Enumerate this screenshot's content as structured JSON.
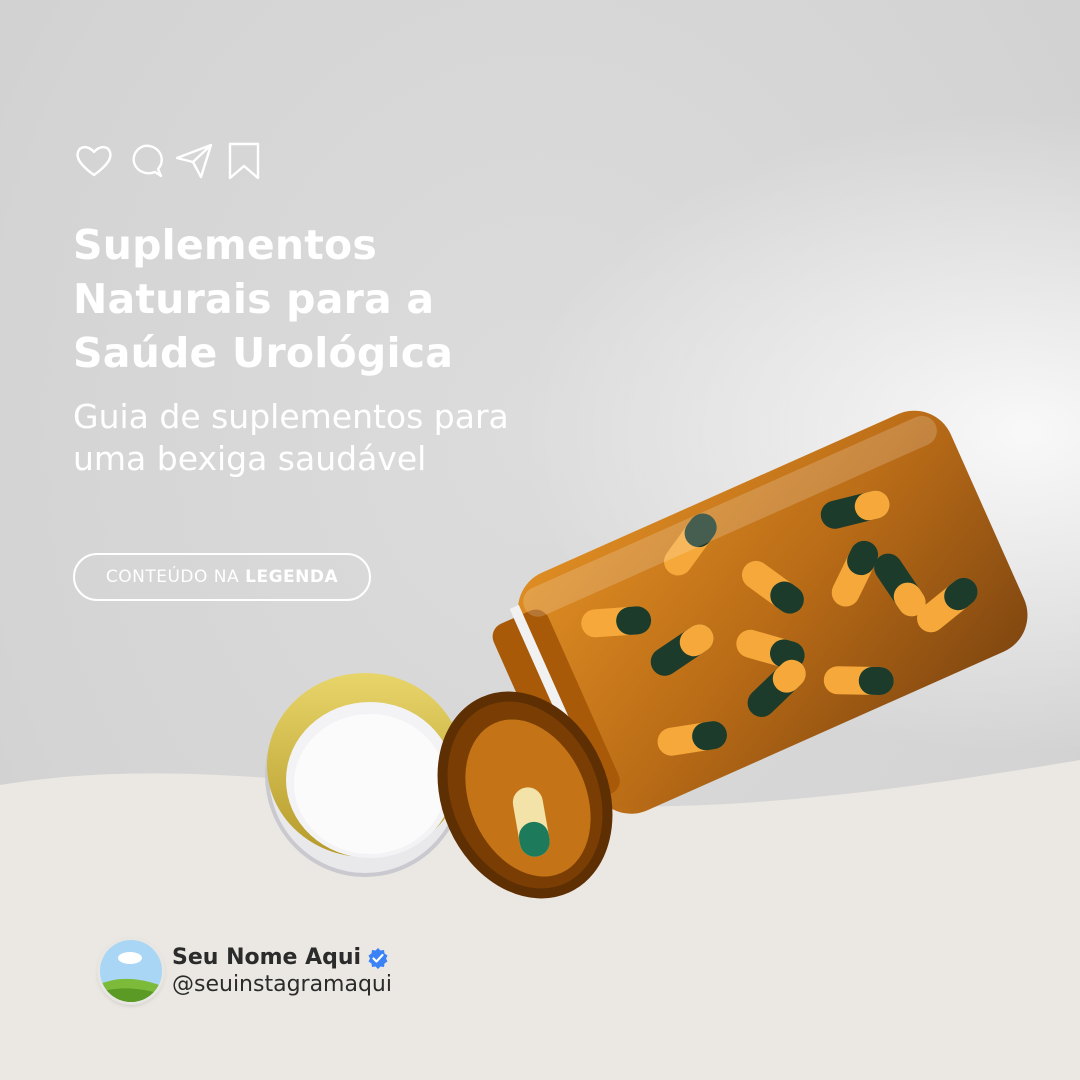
{
  "post": {
    "title": "Suplementos Naturais para a Saúde Urológica",
    "subtitle": "Guia de suplementos para uma bexiga saudável",
    "cta": {
      "normal": "CONTEÚDO NA",
      "bold": "LEGENDA"
    }
  },
  "social_icons": [
    "heart-icon",
    "comment-icon",
    "send-icon",
    "bookmark-icon"
  ],
  "profile": {
    "name": "Seu Nome Aqui",
    "handle": "@seuinstagramaqui",
    "verified": true
  },
  "colors": {
    "background_top": "#d6d6d6",
    "background_bottom": "#ebe8e3",
    "text": "#ffffff",
    "profile_text": "#2b2b2b",
    "verified_badge": "#3b82f6",
    "bottle_amber": "#b8660c",
    "capsule_yellow": "#f6a93a",
    "capsule_green": "#1d3b2a",
    "lid_gold": "#d9c24a"
  }
}
